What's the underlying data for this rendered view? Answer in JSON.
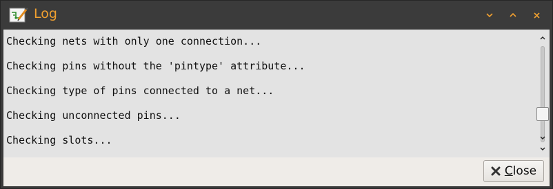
{
  "window": {
    "title": "Log",
    "title_color": "#f0a030",
    "icon": "schematic-editor-icon",
    "controls": [
      "minimize-icon",
      "maximize-icon",
      "close-icon"
    ]
  },
  "log": {
    "lines": [
      "Checking nets with only one connection...",
      "Checking pins without the 'pintype' attribute...",
      "Checking type of pins connected to a net...",
      "Checking unconnected pins...",
      "Checking slots..."
    ]
  },
  "scrollbar": {
    "position_fraction": 0.85
  },
  "footer": {
    "close_label": "Close",
    "close_mnemonic": "C",
    "close_rest": "lose",
    "close_icon": "x-icon"
  }
}
